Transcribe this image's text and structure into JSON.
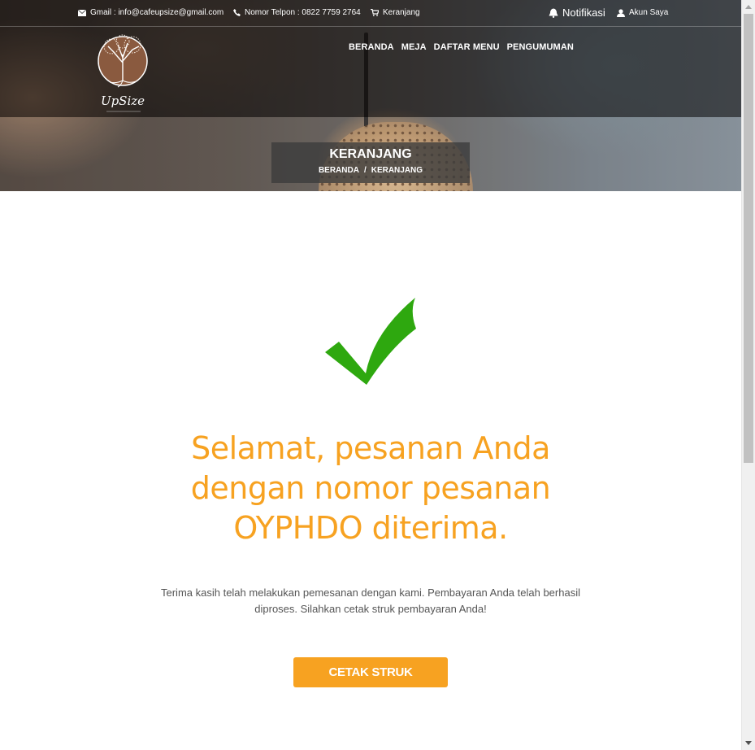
{
  "topbar": {
    "email": "Gmail : info@cafeupsize@gmail.com",
    "phone": "Nomor Telpon : 0822 7759 2764",
    "cart": "Keranjang",
    "notifications": "Notifikasi",
    "account": "Akun Saya"
  },
  "logo": {
    "brand": "UpSize"
  },
  "nav": {
    "items": [
      "BERANDA",
      "MEJA",
      "DAFTAR MENU",
      "PENGUMUMAN"
    ]
  },
  "page_title": {
    "title": "KERANJANG",
    "breadcrumb": [
      "BERANDA",
      "/",
      "KERANJANG"
    ]
  },
  "confirmation": {
    "icon": "checkmark-icon",
    "icon_color": "#2ea80f",
    "headline_line1": "Selamat, pesanan Anda",
    "headline_line2": "dengan nomor pesanan",
    "headline_line3": "OYPHDO diterima.",
    "headline_color": "#f7a221",
    "description_line1": "Terima kasih telah melakukan pemesanan dengan kami. Pembayaran Anda telah berhasil",
    "description_line2": "diproses. Silahkan cetak struk pembayaran Anda!",
    "button_label": "CETAK STRUK",
    "button_color": "#f7a221"
  }
}
